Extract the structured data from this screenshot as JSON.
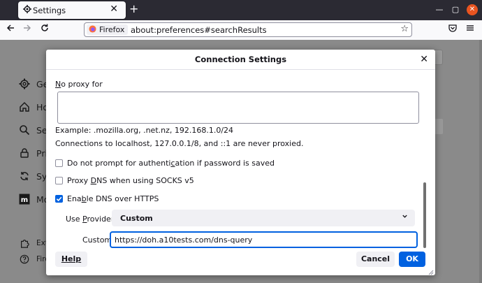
{
  "browser": {
    "tab_title": "Settings",
    "tab_close": "✕",
    "new_tab": "+",
    "identity_label": "Firefox",
    "url": "about:preferences#searchResults",
    "win_min": "—",
    "win_max": "▢",
    "win_close": "✕"
  },
  "sidebar": {
    "items": [
      {
        "label": "Ge",
        "icon": "gear-icon"
      },
      {
        "label": "Ho",
        "icon": "home-icon"
      },
      {
        "label": "Se",
        "icon": "search-icon"
      },
      {
        "label": "Pri",
        "icon": "lock-icon"
      },
      {
        "label": "Sy",
        "icon": "sync-icon"
      },
      {
        "label": "Mo",
        "icon": "mozilla-icon"
      }
    ],
    "footer": [
      {
        "label": "Ext",
        "icon": "puzzle-icon"
      },
      {
        "label": "Fire",
        "icon": "help-icon"
      }
    ]
  },
  "dialog": {
    "title": "Connection Settings",
    "close": "✕",
    "no_proxy_pre": "N",
    "no_proxy_rest": "o proxy for",
    "example": "Example: .mozilla.org, .net.nz, 192.168.1.0/24",
    "localhost_note": "Connections to localhost, 127.0.0.1/8, and ::1 are never proxied.",
    "checkboxes": [
      {
        "pre": "Do not prompt for authenti",
        "key": "c",
        "post": "ation if password is saved",
        "checked": false
      },
      {
        "pre": "Proxy ",
        "key": "D",
        "post": "NS when using SOCKS v5",
        "checked": false
      },
      {
        "pre": "Ena",
        "key": "b",
        "post": "le DNS over HTTPS",
        "checked": true
      }
    ],
    "provider_pre": "Use ",
    "provider_key": "P",
    "provider_post": "rovider",
    "provider_value": "Custom",
    "custom_label": "Custom",
    "custom_value": "https://doh.a10tests.com/dns-query",
    "help_label": "Help",
    "cancel_label": "Cancel",
    "ok_label": "OK"
  },
  "colors": {
    "accent": "#0061e0",
    "ubuntu_close": "#e95420"
  }
}
